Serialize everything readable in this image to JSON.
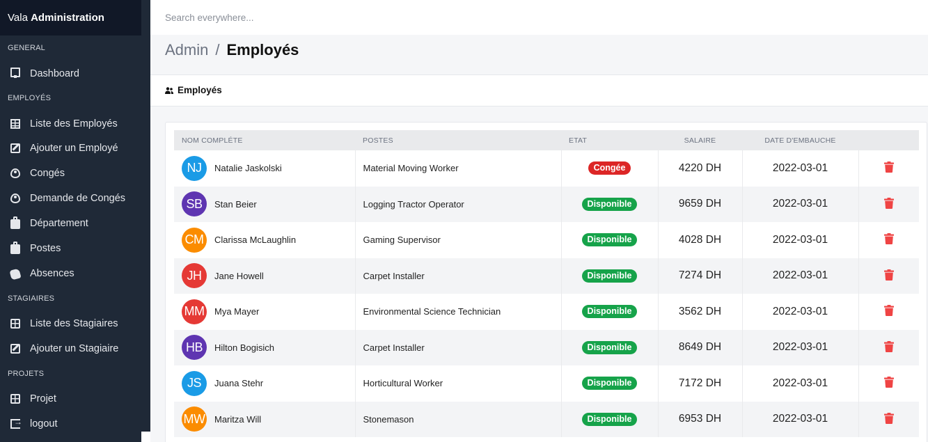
{
  "brand": {
    "prefix": "Vala",
    "bold": "Administration"
  },
  "sidebar": {
    "sections": [
      {
        "label": "GENERAL"
      },
      {
        "label": "EMPLOYÉS"
      },
      {
        "label": "STAGIAIRES"
      },
      {
        "label": "PROJETS"
      }
    ],
    "items": [
      {
        "label": "Dashboard",
        "icon": "monitor-icon"
      },
      {
        "label": "Liste des Employés",
        "icon": "table-icon"
      },
      {
        "label": "Ajouter un Employé",
        "icon": "edit-icon"
      },
      {
        "label": "Congés",
        "icon": "eye-icon"
      },
      {
        "label": "Demande de Congés",
        "icon": "eye-icon"
      },
      {
        "label": "Département",
        "icon": "briefcase-icon"
      },
      {
        "label": "Postes",
        "icon": "briefcase-icon"
      },
      {
        "label": "Absences",
        "icon": "handshake-icon"
      },
      {
        "label": "Liste des Stagiaires",
        "icon": "grid-icon"
      },
      {
        "label": "Ajouter un Stagiaire",
        "icon": "edit-icon"
      },
      {
        "label": "Projet",
        "icon": "grid-icon"
      },
      {
        "label": "logout",
        "icon": "logout-icon"
      }
    ]
  },
  "search": {
    "placeholder": "Search everywhere..."
  },
  "breadcrumb": {
    "root": "Admin",
    "separator": "/",
    "current": "Employés"
  },
  "card": {
    "title": "Employés",
    "icon": "users-icon"
  },
  "table": {
    "headers": [
      "NOM COMPLÉTE",
      "POSTES",
      "ETAT",
      "SALAIRE",
      "DATE D'EMBAUCHE"
    ],
    "rows": [
      {
        "initials": "NJ",
        "avatar_color": "#1a9be6",
        "name": "Natalie Jaskolski",
        "poste": "Material Moving Worker",
        "etat": "Congée",
        "etat_color": "#dc2626",
        "salaire": "4220 DH",
        "date": "2022-03-01"
      },
      {
        "initials": "SB",
        "avatar_color": "#5e35b1",
        "name": "Stan Beier",
        "poste": "Logging Tractor Operator",
        "etat": "Disponible",
        "etat_color": "#16a34a",
        "salaire": "9659 DH",
        "date": "2022-03-01"
      },
      {
        "initials": "CM",
        "avatar_color": "#fb8c00",
        "name": "Clarissa McLaughlin",
        "poste": "Gaming Supervisor",
        "etat": "Disponible",
        "etat_color": "#16a34a",
        "salaire": "4028 DH",
        "date": "2022-03-01"
      },
      {
        "initials": "JH",
        "avatar_color": "#e53935",
        "name": "Jane Howell",
        "poste": "Carpet Installer",
        "etat": "Disponible",
        "etat_color": "#16a34a",
        "salaire": "7274 DH",
        "date": "2022-03-01"
      },
      {
        "initials": "MM",
        "avatar_color": "#e53935",
        "name": "Mya Mayer",
        "poste": "Environmental Science Technician",
        "etat": "Disponible",
        "etat_color": "#16a34a",
        "salaire": "3562 DH",
        "date": "2022-03-01"
      },
      {
        "initials": "HB",
        "avatar_color": "#5e35b1",
        "name": "Hilton Bogisich",
        "poste": "Carpet Installer",
        "etat": "Disponible",
        "etat_color": "#16a34a",
        "salaire": "8649 DH",
        "date": "2022-03-01"
      },
      {
        "initials": "JS",
        "avatar_color": "#1a9be6",
        "name": "Juana Stehr",
        "poste": "Horticultural Worker",
        "etat": "Disponible",
        "etat_color": "#16a34a",
        "salaire": "7172 DH",
        "date": "2022-03-01"
      },
      {
        "initials": "MW",
        "avatar_color": "#fb8c00",
        "name": "Maritza Will",
        "poste": "Stonemason",
        "etat": "Disponible",
        "etat_color": "#16a34a",
        "salaire": "6953 DH",
        "date": "2022-03-01"
      }
    ]
  },
  "colors": {
    "sidebar_bg": "#1f2937",
    "brand_bg": "#111827",
    "delete_red": "#ef4444"
  }
}
